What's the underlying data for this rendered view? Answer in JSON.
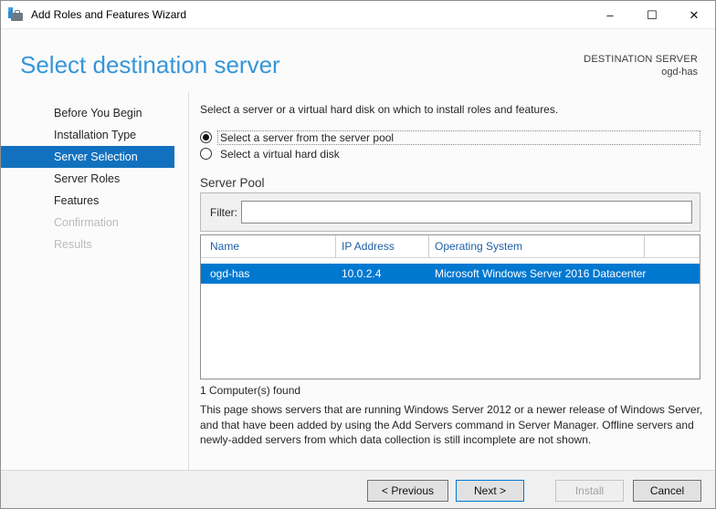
{
  "window": {
    "title": "Add Roles and Features Wizard",
    "controls": {
      "minimize": "–",
      "maximize": "☐",
      "close": "✕"
    }
  },
  "header": {
    "title": "Select destination server",
    "destination_label": "DESTINATION SERVER",
    "destination_value": "ogd-has"
  },
  "sidebar": {
    "items": [
      {
        "label": "Before You Begin",
        "state": "enabled"
      },
      {
        "label": "Installation Type",
        "state": "enabled"
      },
      {
        "label": "Server Selection",
        "state": "active"
      },
      {
        "label": "Server Roles",
        "state": "enabled"
      },
      {
        "label": "Features",
        "state": "enabled"
      },
      {
        "label": "Confirmation",
        "state": "disabled"
      },
      {
        "label": "Results",
        "state": "disabled"
      }
    ]
  },
  "main": {
    "intro": "Select a server or a virtual hard disk on which to install roles and features.",
    "radios": [
      {
        "label": "Select a server from the server pool",
        "selected": true
      },
      {
        "label": "Select a virtual hard disk",
        "selected": false
      }
    ],
    "server_pool": {
      "title": "Server Pool",
      "filter_label": "Filter:",
      "filter_value": "",
      "table": {
        "columns": [
          "Name",
          "IP Address",
          "Operating System"
        ],
        "rows": [
          {
            "name": "ogd-has",
            "ip": "10.0.2.4",
            "os": "Microsoft Windows Server 2016 Datacenter",
            "selected": true
          }
        ]
      },
      "count_text": "1 Computer(s) found"
    },
    "description": "This page shows servers that are running Windows Server 2012 or a newer release of Windows Server, and that have been added by using the Add Servers command in Server Manager. Offline servers and newly-added servers from which data collection is still incomplete are not shown."
  },
  "footer": {
    "buttons": [
      {
        "label": "< Previous",
        "state": "enabled"
      },
      {
        "label": "Next >",
        "state": "default"
      },
      {
        "label": "Install",
        "state": "disabled"
      },
      {
        "label": "Cancel",
        "state": "enabled"
      }
    ]
  },
  "colors": {
    "sidebar_active": "#1271be",
    "row_selected": "#0078d0",
    "heading_blue": "#3696d9",
    "table_header_text": "#1d5fa6"
  }
}
